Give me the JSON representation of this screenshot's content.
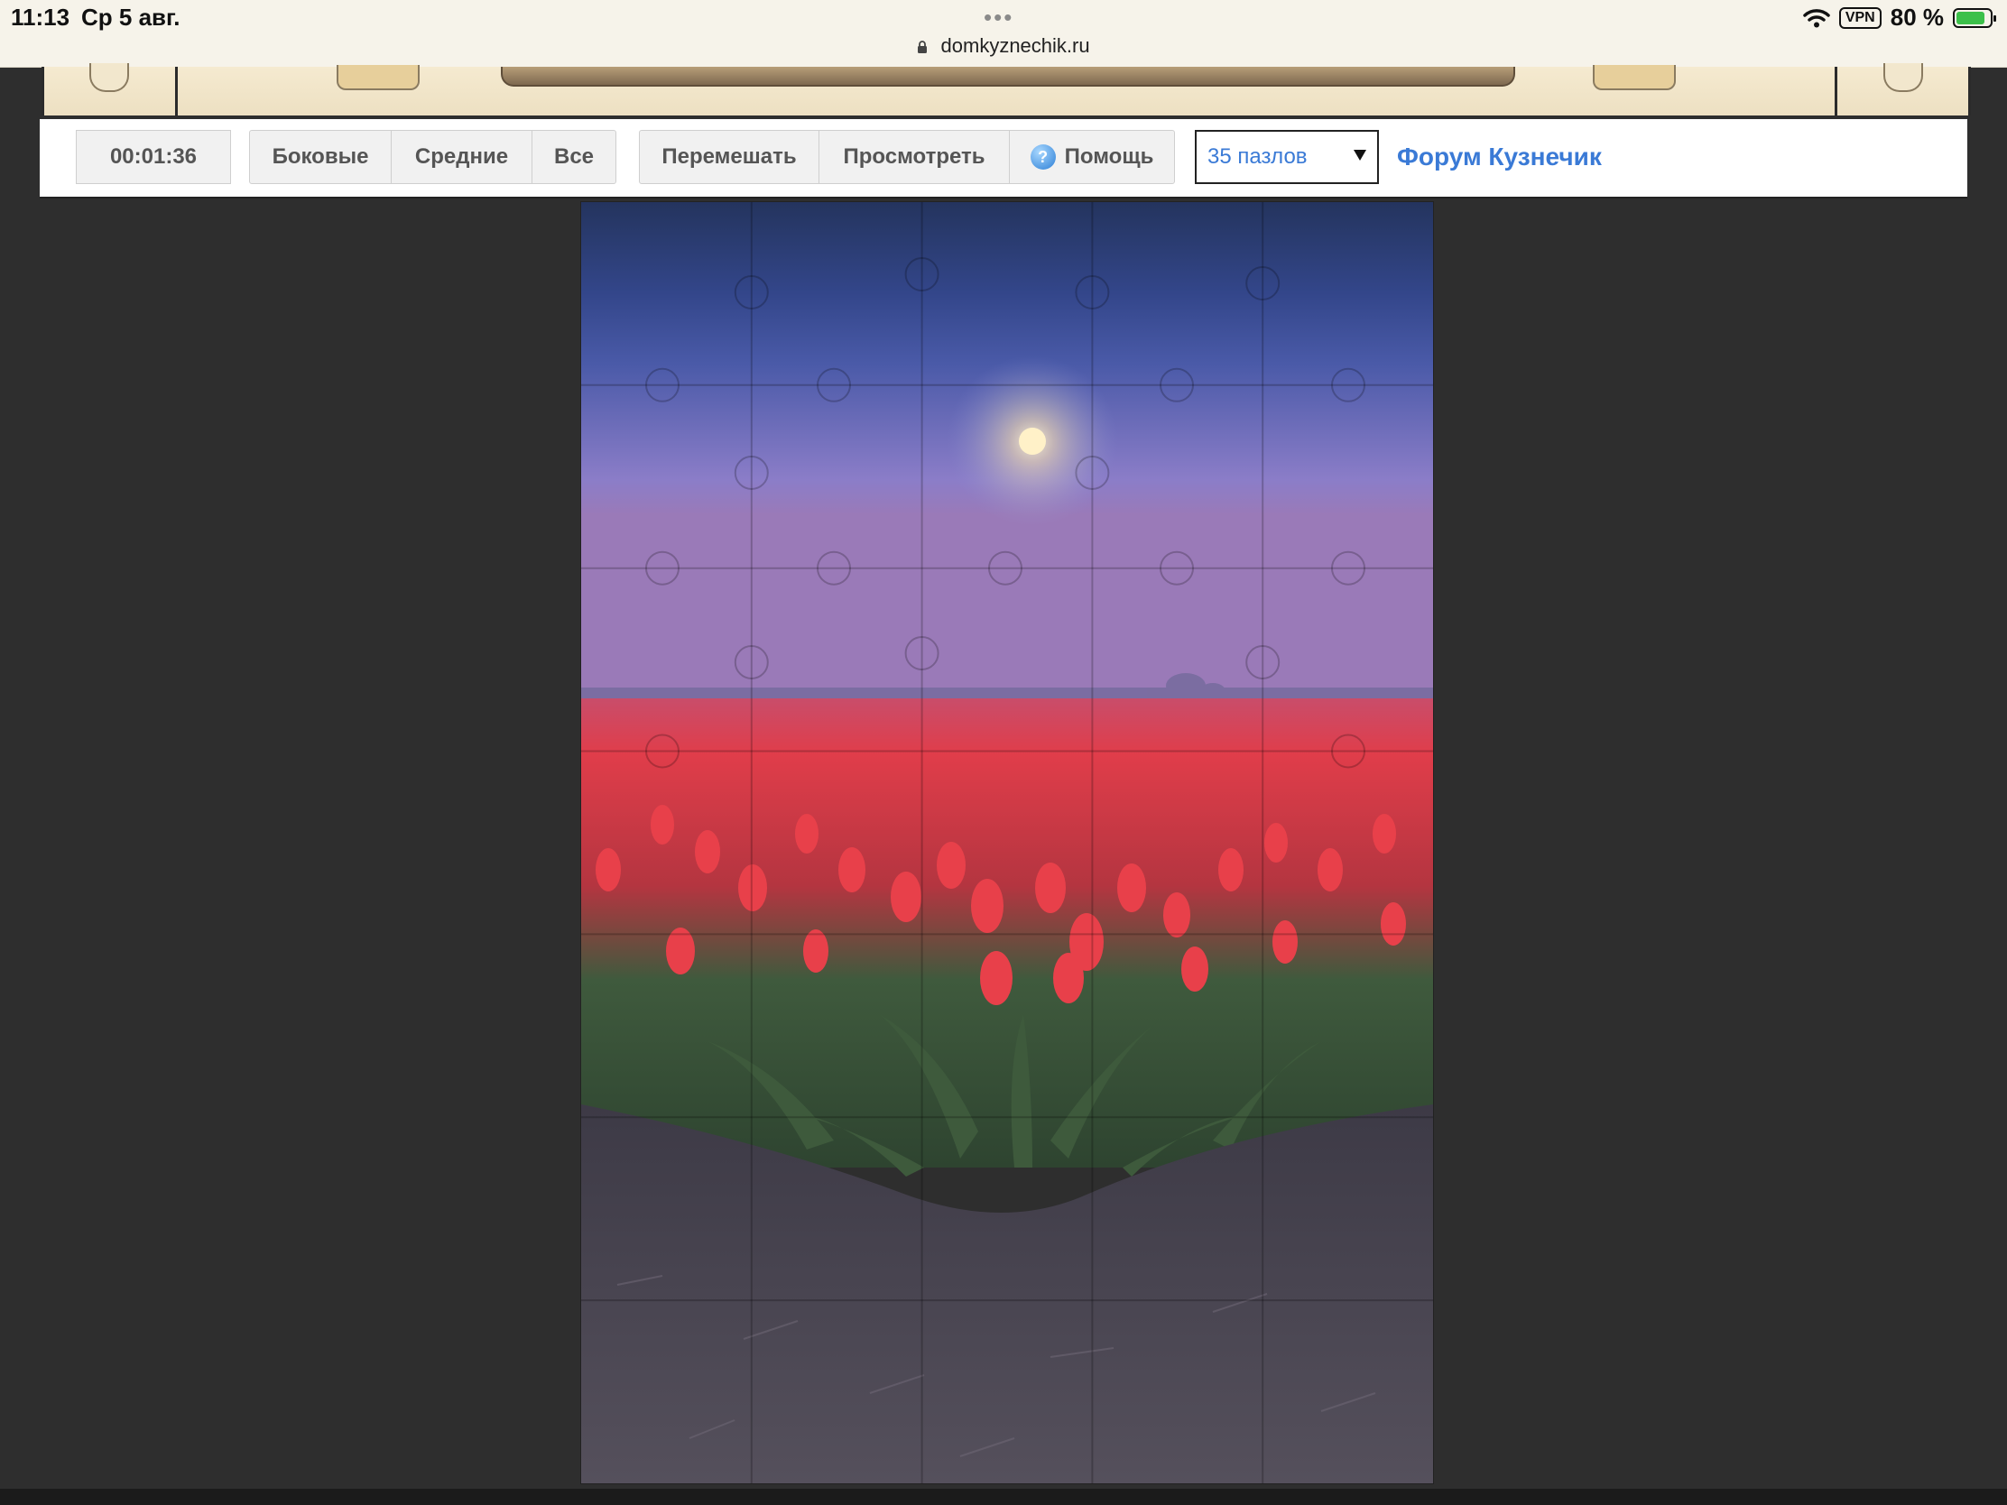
{
  "status_bar": {
    "time": "11:13",
    "date": "Ср 5 авг.",
    "dots": "•••",
    "url": "domkyznechik.ru",
    "vpn": "VPN",
    "battery_percent": "80 %",
    "battery_level": 0.8
  },
  "toolbar": {
    "timer": "00:01:36",
    "filters": [
      "Боковые",
      "Средние",
      "Все"
    ],
    "shuffle_label": "Перемешать",
    "view_label": "Просмотреть",
    "help_label": "Помощь",
    "pieces_select": "35 пазлов",
    "forum_link": "Форум Кузнечик"
  },
  "puzzle": {
    "image_subject": "tulip-field-at-dusk-with-moon",
    "grid_columns": 5,
    "grid_rows": 7,
    "colors": {
      "sky_top": "#24345e",
      "sky_mid": "#4a5aa8",
      "horizon": "#8b7dc8",
      "tulip_red": "#e23b43",
      "leaf_green": "#3e5a3c",
      "soil": "#4a4350",
      "moon": "#fff1c8"
    }
  }
}
